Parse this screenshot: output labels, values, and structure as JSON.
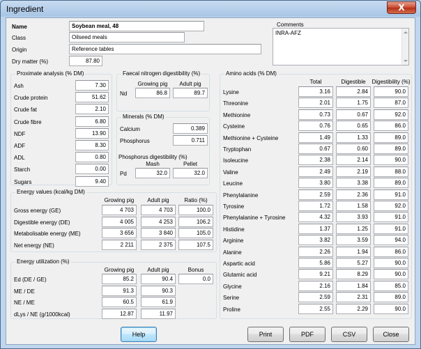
{
  "window": {
    "title": "Ingredient",
    "close_label": "X"
  },
  "header": {
    "name_label": "Name",
    "name_value": "Soybean meal, 48",
    "class_label": "Class",
    "class_value": "Oilseed meals",
    "origin_label": "Origin",
    "origin_value": "Reference tables",
    "dm_label": "Dry matter (%)",
    "dm_value": "87.80",
    "comments_label": "Comments",
    "comments_value": "INRA-AFZ"
  },
  "proximate": {
    "title": "Proximate analysis (% DM)",
    "rows": [
      {
        "label": "Ash",
        "value": "7.30"
      },
      {
        "label": "Crude protein",
        "value": "51.62"
      },
      {
        "label": "Crude fat",
        "value": "2.10"
      },
      {
        "label": "Crude fibre",
        "value": "6.80"
      },
      {
        "label": "NDF",
        "value": "13.90"
      },
      {
        "label": "ADF",
        "value": "8.30"
      },
      {
        "label": "ADL",
        "value": "0.80"
      },
      {
        "label": "Starch",
        "value": "0.00"
      },
      {
        "label": "Sugars",
        "value": "9.40"
      }
    ]
  },
  "faecal": {
    "title": "Faecal nitrogen digestibility (%)",
    "col_growing": "Growing pig",
    "col_adult": "Adult pig",
    "row_label": "Nd",
    "growing": "86.8",
    "adult": "89.7"
  },
  "minerals": {
    "title": "Minerals (% DM)",
    "calcium_label": "Calcium",
    "calcium": "0.389",
    "phosphorus_label": "Phosphorus",
    "phosphorus": "0.711"
  },
  "phos_dig": {
    "title": "Phosphorus digestibility (%)",
    "col_mash": "Mash",
    "col_pellet": "Pellet",
    "row_label": "Pd",
    "mash": "32.0",
    "pellet": "32.0"
  },
  "energy": {
    "title": "Energy values (kcal/kg DM)",
    "col_growing": "Growing pig",
    "col_adult": "Adult pig",
    "col_ratio": "Ratio (%)",
    "rows": [
      {
        "label": "Gross energy (GE)",
        "growing": "4 703",
        "adult": "4 703",
        "ratio": "100.0"
      },
      {
        "label": "Digestible energy (DE)",
        "growing": "4 005",
        "adult": "4 253",
        "ratio": "106.2"
      },
      {
        "label": "Metabolisable energy (ME)",
        "growing": "3 656",
        "adult": "3 840",
        "ratio": "105.0"
      },
      {
        "label": "Net energy (NE)",
        "growing": "2 211",
        "adult": "2 375",
        "ratio": "107.5"
      }
    ]
  },
  "utilization": {
    "title": "Energy utilization (%)",
    "col_growing": "Growing pig",
    "col_adult": "Adult pig",
    "col_bonus": "Bonus",
    "rows": [
      {
        "label": "Ed (DE / GE)",
        "growing": "85.2",
        "adult": "90.4",
        "bonus": "0.0"
      },
      {
        "label": "ME / DE",
        "growing": "91.3",
        "adult": "90.3",
        "bonus": ""
      },
      {
        "label": "NE / ME",
        "growing": "60.5",
        "adult": "61.9",
        "bonus": ""
      },
      {
        "label": "dLys / NE (g/1000kcal)",
        "growing": "12.87",
        "adult": "11.97",
        "bonus": ""
      }
    ]
  },
  "amino": {
    "title": "Amino acids (% DM)",
    "col_total": "Total",
    "col_digestible": "Digestible",
    "col_dig_pct": "Digestibility (%)",
    "rows": [
      {
        "label": "Lysine",
        "total": "3.16",
        "dig": "2.84",
        "pct": "90.0"
      },
      {
        "label": "Threonine",
        "total": "2.01",
        "dig": "1.75",
        "pct": "87.0"
      },
      {
        "label": "Methionine",
        "total": "0.73",
        "dig": "0.67",
        "pct": "92.0"
      },
      {
        "label": "Cysteine",
        "total": "0.76",
        "dig": "0.65",
        "pct": "86.0"
      },
      {
        "label": "Methionine + Cysteine",
        "total": "1.49",
        "dig": "1.33",
        "pct": "89.0"
      },
      {
        "label": "Tryptophan",
        "total": "0.67",
        "dig": "0.60",
        "pct": "89.0"
      },
      {
        "label": "Isoleucine",
        "total": "2.38",
        "dig": "2.14",
        "pct": "90.0"
      },
      {
        "label": "Valine",
        "total": "2.49",
        "dig": "2.19",
        "pct": "88.0"
      },
      {
        "label": "Leucine",
        "total": "3.80",
        "dig": "3.38",
        "pct": "89.0"
      },
      {
        "label": "Phenylalanine",
        "total": "2.59",
        "dig": "2.36",
        "pct": "91.0"
      },
      {
        "label": "Tyrosine",
        "total": "1.72",
        "dig": "1.58",
        "pct": "92.0"
      },
      {
        "label": "Phenylalanine + Tyrosine",
        "total": "4.32",
        "dig": "3.93",
        "pct": "91.0"
      },
      {
        "label": "Histidine",
        "total": "1.37",
        "dig": "1.25",
        "pct": "91.0"
      },
      {
        "label": "Arginine",
        "total": "3.82",
        "dig": "3.59",
        "pct": "94.0"
      },
      {
        "label": "Alanine",
        "total": "2.26",
        "dig": "1.94",
        "pct": "86.0"
      },
      {
        "label": "Aspartic acid",
        "total": "5.86",
        "dig": "5.27",
        "pct": "90.0"
      },
      {
        "label": "Glutamic acid",
        "total": "9.21",
        "dig": "8.29",
        "pct": "90.0"
      },
      {
        "label": "Glycine",
        "total": "2.16",
        "dig": "1.84",
        "pct": "85.0"
      },
      {
        "label": "Serine",
        "total": "2.59",
        "dig": "2.31",
        "pct": "89.0"
      },
      {
        "label": "Proline",
        "total": "2.55",
        "dig": "2.29",
        "pct": "90.0"
      }
    ]
  },
  "buttons": {
    "help": "Help",
    "print": "Print",
    "pdf": "PDF",
    "csv": "CSV",
    "close": "Close"
  }
}
